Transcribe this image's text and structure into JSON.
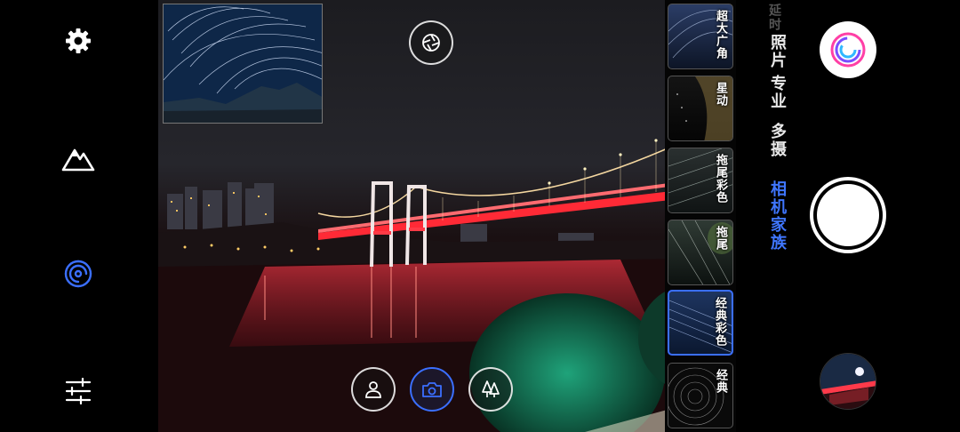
{
  "left_bar": {
    "icons": [
      "gear-icon",
      "mountain-icon",
      "swirl-icon",
      "sliders-icon"
    ],
    "accent": "#3b6fff"
  },
  "viewfinder": {
    "bottom_buttons": [
      "portrait-icon",
      "camera-icon",
      "trees-icon"
    ],
    "active_button": "camera-icon",
    "top_icon": "aperture-icon"
  },
  "modes": [
    {
      "label": "超大广角"
    },
    {
      "label": "星动"
    },
    {
      "label": "拖尾彩色"
    },
    {
      "label": "拖尾"
    },
    {
      "label": "经典彩色"
    },
    {
      "label": "经典"
    }
  ],
  "selected_mode": "经典彩色",
  "right_panel": {
    "tabs": [
      {
        "label": "延时",
        "state": "faded"
      },
      {
        "label": "照片",
        "state": "normal"
      },
      {
        "label": "专业",
        "state": "normal"
      },
      {
        "label": "多摄",
        "state": "normal"
      },
      {
        "label": "相机家族",
        "state": "active"
      }
    ],
    "accent": "#3f76ff"
  }
}
